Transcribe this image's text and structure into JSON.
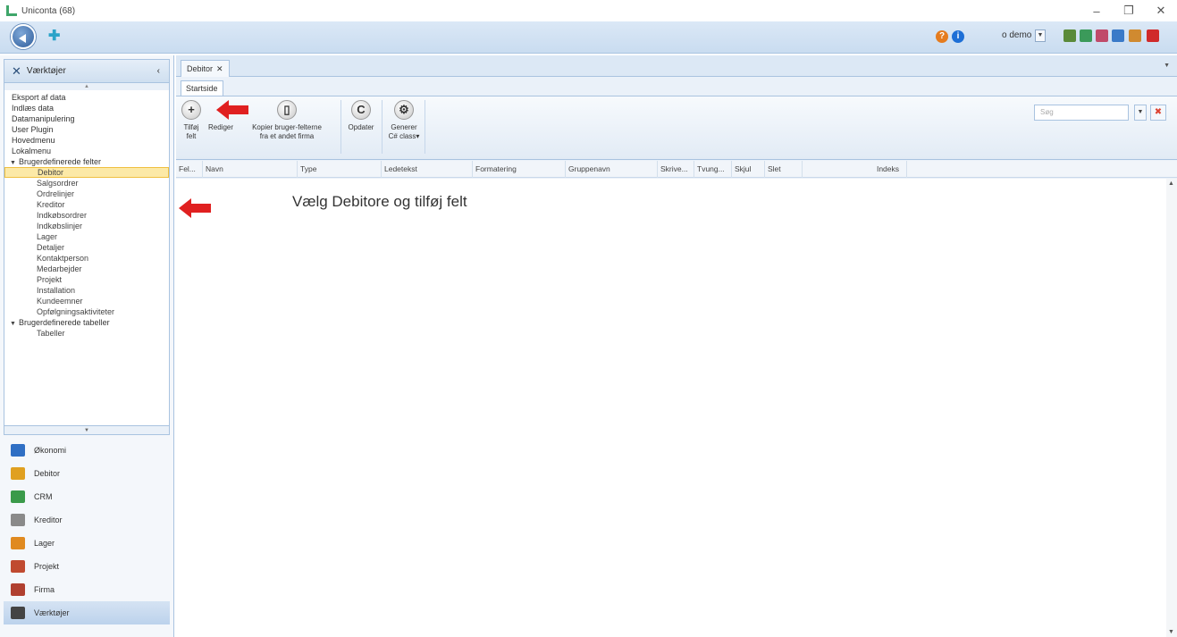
{
  "window": {
    "title": "Uniconta (68)",
    "controls": [
      "–",
      "❐",
      "✕"
    ]
  },
  "topbar": {
    "user": "o demo",
    "help": "?",
    "info": "i"
  },
  "sidebar": {
    "header": "Værktøjer",
    "items": [
      {
        "label": "Eksport af data",
        "level": 0
      },
      {
        "label": "Indlæs data",
        "level": 0
      },
      {
        "label": "Datamanipulering",
        "level": 0
      },
      {
        "label": "User Plugin",
        "level": 0
      },
      {
        "label": "Hovedmenu",
        "level": 0
      },
      {
        "label": "Lokalmenu",
        "level": 0
      },
      {
        "label": "Brugerdefinerede felter",
        "level": "group"
      },
      {
        "label": "Debitor",
        "level": 1,
        "selected": true
      },
      {
        "label": "Salgsordrer",
        "level": 1
      },
      {
        "label": "Ordrelinjer",
        "level": 1
      },
      {
        "label": "Kreditor",
        "level": 1
      },
      {
        "label": "Indkøbsordrer",
        "level": 1
      },
      {
        "label": "Indkøbslinjer",
        "level": 1
      },
      {
        "label": "Lager",
        "level": 1
      },
      {
        "label": "Detaljer",
        "level": 1
      },
      {
        "label": "Kontaktperson",
        "level": 1
      },
      {
        "label": "Medarbejder",
        "level": 1
      },
      {
        "label": "Projekt",
        "level": 1
      },
      {
        "label": "Installation",
        "level": 1
      },
      {
        "label": "Kundeemner",
        "level": 1
      },
      {
        "label": "Opfølgningsaktiviteter",
        "level": 1
      },
      {
        "label": "Brugerdefinerede tabeller",
        "level": "group"
      },
      {
        "label": "Tabeller",
        "level": 1
      }
    ],
    "modules": [
      {
        "label": "Økonomi",
        "color": "#2f6fc4"
      },
      {
        "label": "Debitor",
        "color": "#e0a020"
      },
      {
        "label": "CRM",
        "color": "#3a9a4a"
      },
      {
        "label": "Kreditor",
        "color": "#8a8a8a"
      },
      {
        "label": "Lager",
        "color": "#e08a20"
      },
      {
        "label": "Projekt",
        "color": "#c04a30"
      },
      {
        "label": "Firma",
        "color": "#b04030"
      },
      {
        "label": "Værktøjer",
        "color": "#444444"
      }
    ]
  },
  "main": {
    "doc_tab": "Debitor",
    "ribbon_tab": "Startside",
    "buttons": {
      "add_line1": "Tilføj",
      "add_line2": "felt",
      "edit": "Rediger",
      "copy_line1": "Kopier bruger-felterne",
      "copy_line2": "fra et andet firma",
      "refresh": "Opdater",
      "gen_line1": "Generer",
      "gen_line2": "C# class"
    },
    "search_placeholder": "Søg",
    "columns": [
      "Fel...",
      "Navn",
      "Type",
      "Ledetekst",
      "Formatering",
      "Gruppenavn",
      "Skrive...",
      "Tvung...",
      "Skjul",
      "Slet",
      "Indeks"
    ],
    "instruction": "Vælg Debitore og tilføj felt"
  }
}
